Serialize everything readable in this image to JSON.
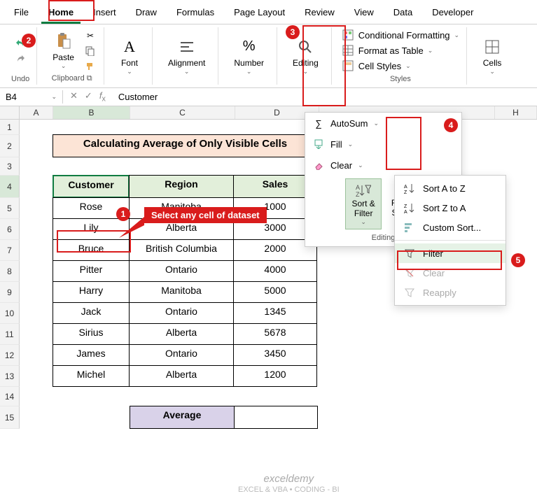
{
  "tabs": [
    "File",
    "Home",
    "Insert",
    "Draw",
    "Formulas",
    "Page Layout",
    "Review",
    "View",
    "Data",
    "Developer"
  ],
  "ribbon": {
    "undo": "Undo",
    "clipboard": "Clipboard",
    "paste": "Paste",
    "font": "Font",
    "alignment": "Alignment",
    "number": "Number",
    "editing": "Editing",
    "styles_label": "Styles",
    "cells": "Cells",
    "styles": {
      "cond": "Conditional Formatting",
      "table": "Format as Table",
      "cell": "Cell Styles"
    }
  },
  "namebox": "B4",
  "formula": "Customer",
  "cols": [
    "A",
    "B",
    "C",
    "D",
    "H"
  ],
  "rows": [
    "1",
    "2",
    "3",
    "4",
    "5",
    "6",
    "7",
    "8",
    "9",
    "10",
    "11",
    "12",
    "13",
    "14",
    "15"
  ],
  "title": "Calculating Average of Only Visible Cells",
  "headers": {
    "c1": "Customer",
    "c2": "Region",
    "c3": "Sales"
  },
  "data": [
    {
      "c": "Rose",
      "r": "Manitoba",
      "s": "1000"
    },
    {
      "c": "Lily",
      "r": "Alberta",
      "s": "3000"
    },
    {
      "c": "Bruce",
      "r": "British Columbia",
      "s": "2000"
    },
    {
      "c": "Pitter",
      "r": "Ontario",
      "s": "4000"
    },
    {
      "c": "Harry",
      "r": "Manitoba",
      "s": "5000"
    },
    {
      "c": "Jack",
      "r": "Ontario",
      "s": "1345"
    },
    {
      "c": "Sirius",
      "r": "Alberta",
      "s": "5678"
    },
    {
      "c": "James",
      "r": "Ontario",
      "s": "3450"
    },
    {
      "c": "Michel",
      "r": "Alberta",
      "s": "1200"
    }
  ],
  "average_label": "Average",
  "tip": "Select any cell of dataset",
  "edit_menu": {
    "autosum": "AutoSum",
    "fill": "Fill",
    "clear": "Clear",
    "sortfilter": "Sort &\nFilter",
    "findselect": "Find &\nSelect",
    "label": "Editing"
  },
  "sf_menu": {
    "asc": "Sort A to Z",
    "desc": "Sort Z to A",
    "custom": "Custom Sort...",
    "filter": "Filter",
    "clear": "Clear",
    "reapply": "Reapply"
  },
  "nums": {
    "n1": "1",
    "n2": "2",
    "n3": "3",
    "n4": "4",
    "n5": "5"
  },
  "watermark": {
    "l1": "exceldemy",
    "l2": "EXCEL & VBA • CODING - BI"
  }
}
